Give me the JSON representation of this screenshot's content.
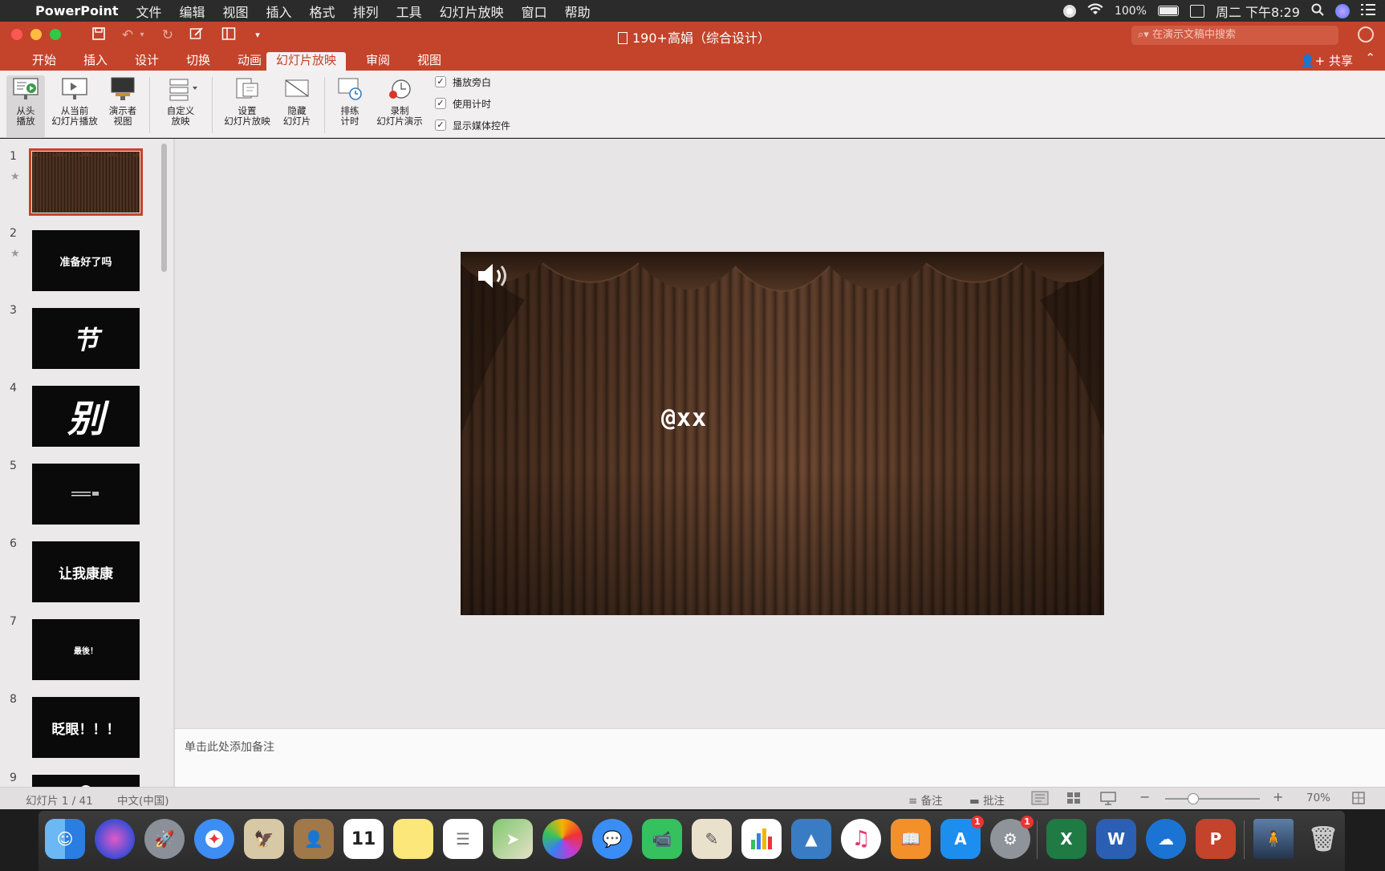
{
  "menubar": {
    "app": "PowerPoint",
    "items": [
      "文件",
      "编辑",
      "视图",
      "插入",
      "格式",
      "排列",
      "工具",
      "幻灯片放映",
      "窗口",
      "帮助"
    ],
    "battery": "100%",
    "clock": "周二 下午8:29"
  },
  "titlebar": {
    "doc_title": "190+高娟（综合设计）",
    "search_placeholder": "在演示文稿中搜索"
  },
  "tabs": [
    "开始",
    "插入",
    "设计",
    "切换",
    "动画",
    "幻灯片放映",
    "审阅",
    "视图"
  ],
  "active_tab": "幻灯片放映",
  "share_label": "共享",
  "ribbon": {
    "from_beginning": [
      "从头",
      "播放"
    ],
    "from_current": [
      "从当前",
      "幻灯片播放"
    ],
    "presenter_view": [
      "演示者",
      "视图"
    ],
    "custom_show": [
      "自定义",
      "放映"
    ],
    "setup_show": [
      "设置",
      "幻灯片放映"
    ],
    "hide_slide": [
      "隐藏",
      "幻灯片"
    ],
    "rehearse": [
      "排练",
      "计时"
    ],
    "record": [
      "录制",
      "幻灯片演示"
    ],
    "checks": [
      {
        "label": "播放旁白",
        "checked": true
      },
      {
        "label": "使用计时",
        "checked": true
      },
      {
        "label": "显示媒体控件",
        "checked": true
      }
    ]
  },
  "thumbnails": [
    {
      "num": "1",
      "text": "",
      "starred": true
    },
    {
      "num": "2",
      "text": "准备好了吗",
      "starred": true
    },
    {
      "num": "3",
      "text": "节",
      "starred": false
    },
    {
      "num": "4",
      "text": "别",
      "starred": false
    },
    {
      "num": "5",
      "text": "",
      "starred": false
    },
    {
      "num": "6",
      "text": "让我康康",
      "starred": false
    },
    {
      "num": "7",
      "text": "最後！",
      "starred": false
    },
    {
      "num": "8",
      "text": "眨眼！！！",
      "starred": false
    },
    {
      "num": "9",
      "text": "",
      "starred": false
    }
  ],
  "slide": {
    "watermark": "@xx"
  },
  "notes_placeholder": "单击此处添加备注",
  "statusbar": {
    "slide_info": "幻灯片 1 / 41",
    "language": "中文(中国)",
    "notes_btn": "备注",
    "comments_btn": "批注",
    "zoom": "70%",
    "zoom_level": 0.3
  },
  "colors": {
    "accent": "#c4432b"
  }
}
